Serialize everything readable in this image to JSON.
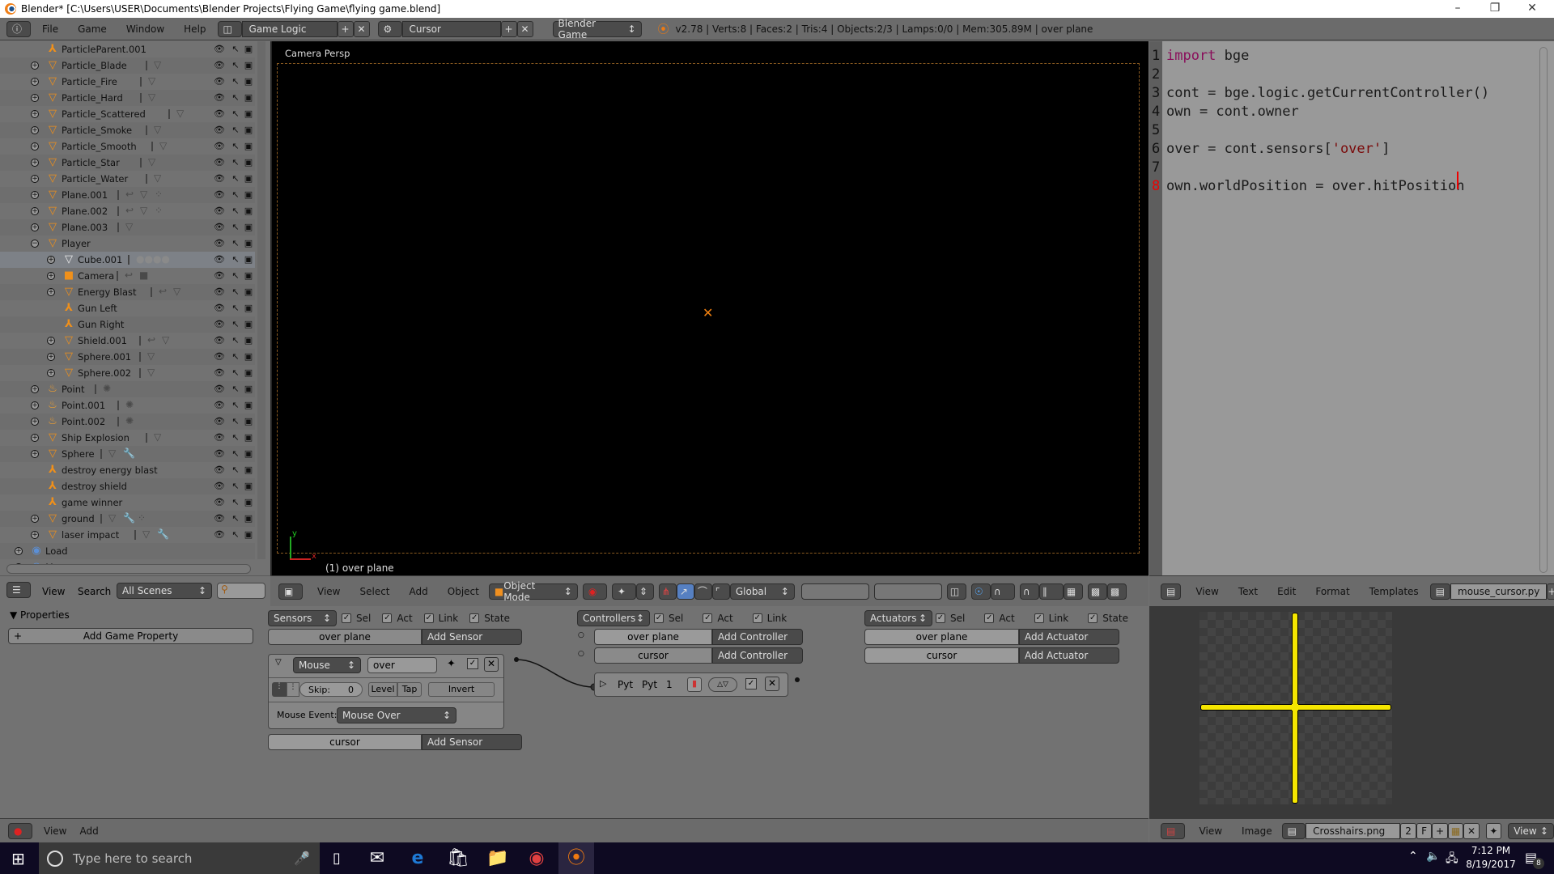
{
  "window": {
    "title": "Blender* [C:\\Users\\USER\\Documents\\Blender Projects\\Flying Game\\flying game.blend]",
    "controls": [
      "minimize",
      "maximize",
      "close"
    ]
  },
  "info_header": {
    "menus": [
      "File",
      "Game",
      "Window",
      "Help"
    ],
    "screen_layout": "Game Logic",
    "scene": "Cursor",
    "engine": "Blender Game",
    "stats": "v2.78 | Verts:8 | Faces:2 | Tris:4 | Objects:2/3 | Lamps:0/0 | Mem:305.89M | over plane"
  },
  "outliner": {
    "items": [
      {
        "name": "ParticleParent.001",
        "type": "empty",
        "depth": 1,
        "expand": "",
        "extras": ""
      },
      {
        "name": "Particle_Blade",
        "type": "mesh",
        "depth": 1,
        "expand": "+",
        "extras": "mesh"
      },
      {
        "name": "Particle_Fire",
        "type": "mesh",
        "depth": 1,
        "expand": "+",
        "extras": "mesh"
      },
      {
        "name": "Particle_Hard",
        "type": "mesh",
        "depth": 1,
        "expand": "+",
        "extras": "mesh"
      },
      {
        "name": "Particle_Scattered",
        "type": "mesh",
        "depth": 1,
        "expand": "+",
        "extras": "mesh"
      },
      {
        "name": "Particle_Smoke",
        "type": "mesh",
        "depth": 1,
        "expand": "+",
        "extras": "mesh"
      },
      {
        "name": "Particle_Smooth",
        "type": "mesh",
        "depth": 1,
        "expand": "+",
        "extras": "mesh"
      },
      {
        "name": "Particle_Star",
        "type": "mesh",
        "depth": 1,
        "expand": "+",
        "extras": "mesh"
      },
      {
        "name": "Particle_Water",
        "type": "mesh",
        "depth": 1,
        "expand": "+",
        "extras": "mesh"
      },
      {
        "name": "Plane.001",
        "type": "mesh",
        "depth": 1,
        "expand": "+",
        "extras": "logic mesh particles"
      },
      {
        "name": "Plane.002",
        "type": "mesh",
        "depth": 1,
        "expand": "+",
        "extras": "logic mesh particles"
      },
      {
        "name": "Plane.003",
        "type": "mesh",
        "depth": 1,
        "expand": "+",
        "extras": "mesh"
      },
      {
        "name": "Player",
        "type": "mesh",
        "depth": 1,
        "expand": "−",
        "extras": ""
      },
      {
        "name": "Cube.001",
        "type": "mesh-white",
        "depth": 2,
        "expand": "+",
        "extras": "materials",
        "selected": true
      },
      {
        "name": "Camera",
        "type": "camera",
        "depth": 2,
        "expand": "+",
        "extras": "logic camera"
      },
      {
        "name": "Energy Blast",
        "type": "mesh",
        "depth": 2,
        "expand": "+",
        "extras": "logic mesh"
      },
      {
        "name": "Gun Left",
        "type": "empty",
        "depth": 2,
        "expand": "",
        "extras": ""
      },
      {
        "name": "Gun Right",
        "type": "empty",
        "depth": 2,
        "expand": "",
        "extras": ""
      },
      {
        "name": "Shield.001",
        "type": "mesh",
        "depth": 2,
        "expand": "+",
        "extras": "logic mesh"
      },
      {
        "name": "Sphere.001",
        "type": "mesh",
        "depth": 2,
        "expand": "+",
        "extras": "mesh"
      },
      {
        "name": "Sphere.002",
        "type": "mesh",
        "depth": 2,
        "expand": "+",
        "extras": "mesh"
      },
      {
        "name": "Point",
        "type": "lamp",
        "depth": 1,
        "expand": "+",
        "extras": "lamp"
      },
      {
        "name": "Point.001",
        "type": "lamp",
        "depth": 1,
        "expand": "+",
        "extras": "lamp"
      },
      {
        "name": "Point.002",
        "type": "lamp",
        "depth": 1,
        "expand": "+",
        "extras": "lamp"
      },
      {
        "name": "Ship Explosion",
        "type": "mesh",
        "depth": 1,
        "expand": "+",
        "extras": "mesh"
      },
      {
        "name": "Sphere",
        "type": "mesh",
        "depth": 1,
        "expand": "+",
        "extras": "mesh modifier"
      },
      {
        "name": "destroy energy blast",
        "type": "empty",
        "depth": 1,
        "expand": "",
        "extras": ""
      },
      {
        "name": "destroy shield",
        "type": "empty",
        "depth": 1,
        "expand": "",
        "extras": ""
      },
      {
        "name": "game winner",
        "type": "empty",
        "depth": 1,
        "expand": "",
        "extras": ""
      },
      {
        "name": "ground",
        "type": "mesh",
        "depth": 1,
        "expand": "+",
        "extras": "mesh modifier particles"
      },
      {
        "name": "laser impact",
        "type": "mesh",
        "depth": 1,
        "expand": "+",
        "extras": "mesh modifier"
      },
      {
        "name": "Load",
        "type": "scene",
        "depth": 0,
        "expand": "+",
        "extras": ""
      },
      {
        "name": "Menu",
        "type": "scene",
        "depth": 0,
        "expand": "+",
        "extras": ""
      }
    ],
    "footer": {
      "menus": [
        "View",
        "Search"
      ],
      "filter": "All Scenes",
      "search_placeholder": ""
    }
  },
  "viewport": {
    "view_label": "Camera Persp",
    "object_label": "(1) over plane",
    "axis_x": "x",
    "axis_y": "y",
    "footer": {
      "menus": [
        "View",
        "Select",
        "Add",
        "Object"
      ],
      "mode": "Object Mode",
      "orientation": "Global"
    }
  },
  "text_editor": {
    "lines": [
      {
        "n": "1",
        "code": "import bge"
      },
      {
        "n": "2",
        "code": ""
      },
      {
        "n": "3",
        "code": "cont = bge.logic.getCurrentController()"
      },
      {
        "n": "4",
        "code": "own = cont.owner"
      },
      {
        "n": "5",
        "code": ""
      },
      {
        "n": "6",
        "code": "over = cont.sensors['over']"
      },
      {
        "n": "7",
        "code": ""
      },
      {
        "n": "8",
        "code": "own.worldPosition = over.hitPosition"
      }
    ],
    "current_line": "8",
    "footer": {
      "menus": [
        "View",
        "Text",
        "Edit",
        "Format",
        "Templates"
      ],
      "filename": "mouse_cursor.py"
    }
  },
  "properties": {
    "title": "Properties",
    "add_button": "Add Game Property"
  },
  "logic": {
    "sensors": {
      "menu": "Sensors",
      "filters": [
        "Sel",
        "Act",
        "Link",
        "State"
      ],
      "objects": [
        {
          "name": "over plane",
          "add": "Add Sensor"
        },
        {
          "name": "cursor",
          "add": "Add Sensor"
        }
      ],
      "brick": {
        "type": "Mouse",
        "name": "over",
        "skip_label": "Skip:",
        "skip_value": "0",
        "level": "Level",
        "tap": "Tap",
        "invert": "Invert",
        "event_label": "Mouse Event:",
        "event_value": "Mouse Over"
      }
    },
    "controllers": {
      "menu": "Controllers",
      "filters": [
        "Sel",
        "Act",
        "Link"
      ],
      "objects": [
        {
          "name": "over plane",
          "add": "Add Controller"
        },
        {
          "name": "cursor",
          "add": "Add Controller"
        }
      ],
      "brick": {
        "type": "Pyt",
        "name": "Pyt",
        "state": "1"
      }
    },
    "actuators": {
      "menu": "Actuators",
      "filters": [
        "Sel",
        "Act",
        "Link",
        "State"
      ],
      "objects": [
        {
          "name": "over plane",
          "add": "Add Actuator"
        },
        {
          "name": "cursor",
          "add": "Add Actuator"
        }
      ]
    },
    "footer": {
      "menus": [
        "View",
        "Add"
      ]
    }
  },
  "image_editor": {
    "image_color": "#f5e600",
    "footer": {
      "menus": [
        "View",
        "Image"
      ],
      "image_name": "Crosshairs.png",
      "users": "2",
      "fake_user": "F",
      "view_mode": "View"
    }
  },
  "taskbar": {
    "search_placeholder": "Type here to search",
    "apps": [
      "task-view",
      "mail",
      "edge",
      "store",
      "file-explorer",
      "chrome",
      "blender"
    ],
    "time": "7:12 PM",
    "date": "8/19/2017",
    "notifications": "8"
  }
}
